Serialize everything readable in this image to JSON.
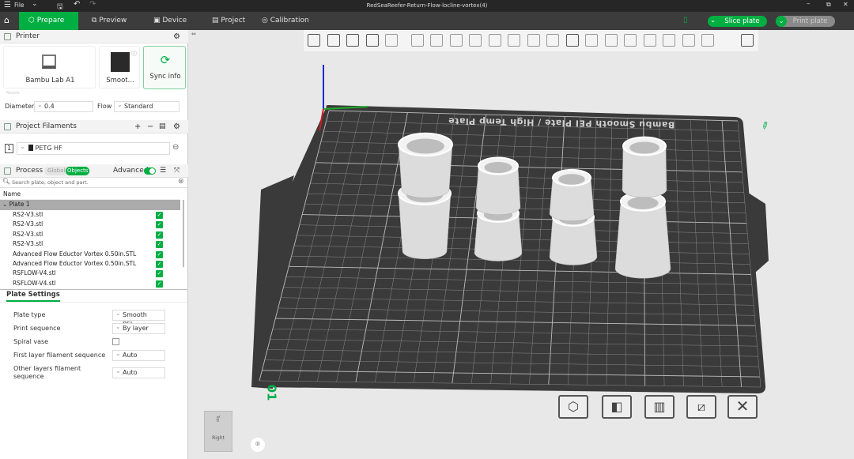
{
  "titlebar": {
    "menu_label": "File",
    "title": "RedSeaReefer-Return-Flow-locline-vortex(4)"
  },
  "tabs": [
    {
      "label": "Prepare",
      "active": true
    },
    {
      "label": "Preview"
    },
    {
      "label": "Device"
    },
    {
      "label": "Project"
    },
    {
      "label": "Calibration"
    }
  ],
  "actions": {
    "slice": "Slice plate",
    "print": "Print plate"
  },
  "colors": {
    "accent": "#00ae42",
    "titlebar": "#262626",
    "tabbar": "#3c3c3c",
    "bed": "#3a3a3a",
    "viewport": "#e8e8e8"
  },
  "printer": {
    "header": "Printer",
    "printer_name": "Bambu Lab A1",
    "plate_name": "Smoot...",
    "sync": "Sync info",
    "nozzle_label": "Nozzle",
    "diameter_label": "Diameter",
    "diameter": "0.4",
    "flow_label": "Flow",
    "flow": "Standard"
  },
  "filaments": {
    "header": "Project Filaments",
    "items": [
      {
        "index": "1",
        "name": "PETG HF"
      }
    ]
  },
  "process": {
    "header": "Process",
    "global": "Global",
    "objects": "Objects",
    "advanced": "Advanced",
    "advanced_on": true
  },
  "search": {
    "placeholder": "Search plate, object and part."
  },
  "objects": {
    "column": "Name",
    "plate": "Plate 1",
    "items": [
      "RS2-V3.stl",
      "RS2-V3.stl",
      "RS2-V3.stl",
      "RS2-V3.stl",
      "Advanced Flow Eductor Vortex 0.50in.STL",
      "Advanced Flow Eductor Vortex 0.50in.STL",
      "RSFLOW-V4.stl",
      "RSFLOW-V4.stl"
    ]
  },
  "plate_settings": {
    "tab": "Plate Settings",
    "rows": [
      {
        "label": "Plate type",
        "value": "Smooth PEI..."
      },
      {
        "label": "Print sequence",
        "value": "By layer"
      },
      {
        "label": "Spiral vase",
        "checked": false
      },
      {
        "label": "First layer filament sequence",
        "value": "Auto"
      },
      {
        "label": "Other layers filament sequence",
        "value": "Auto"
      }
    ]
  },
  "viewport": {
    "bed_text": "Bambu Smooth PEI Plate / High Temp Plate",
    "plate_number": "01",
    "view_cube_label": "Right",
    "view_cube_top": "Top"
  }
}
